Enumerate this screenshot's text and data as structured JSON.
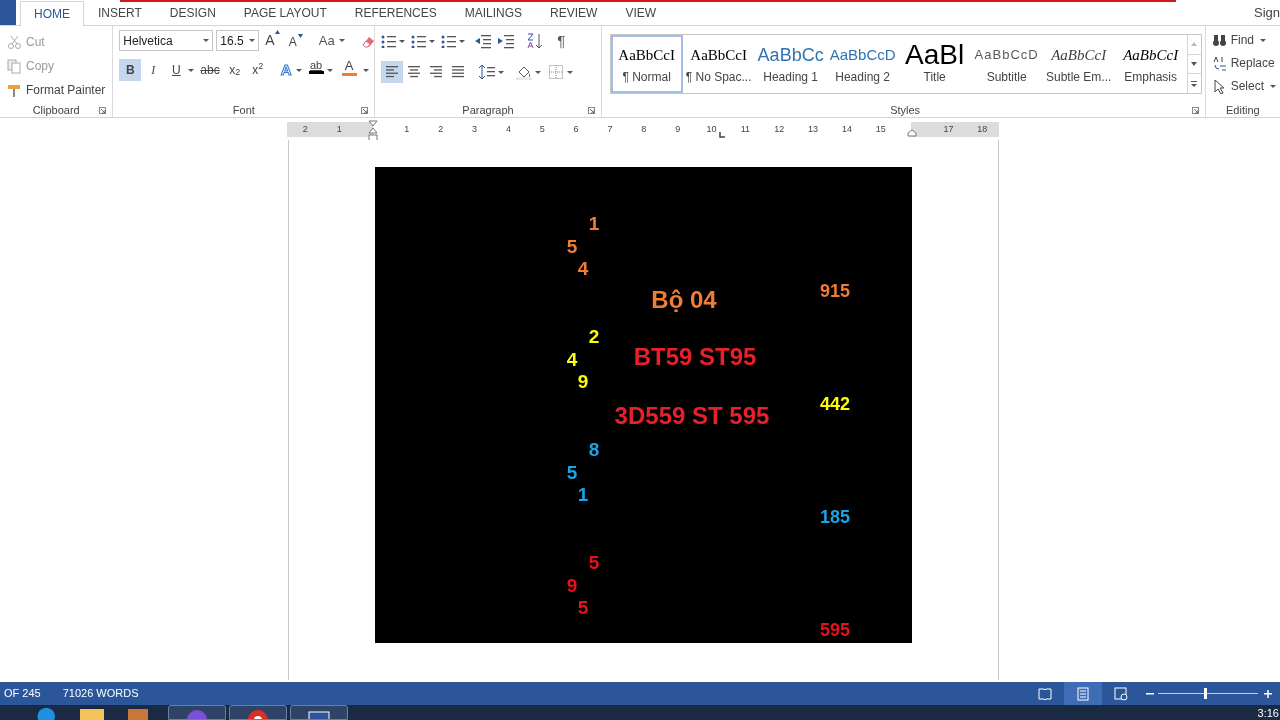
{
  "tabs": [
    {
      "label": "HOME",
      "selected": true
    },
    {
      "label": "INSERT",
      "selected": false
    },
    {
      "label": "DESIGN",
      "selected": false
    },
    {
      "label": "PAGE LAYOUT",
      "selected": false
    },
    {
      "label": "REFERENCES",
      "selected": false
    },
    {
      "label": "MAILINGS",
      "selected": false
    },
    {
      "label": "REVIEW",
      "selected": false
    },
    {
      "label": "VIEW",
      "selected": false
    }
  ],
  "account": "Sign",
  "clipboard": {
    "label": "Clipboard",
    "commands": [
      "Cut",
      "Copy",
      "Format Painter"
    ]
  },
  "font": {
    "label": "Font",
    "name": "Helvetica",
    "size": "16.5",
    "grow": "A",
    "shrink": "A",
    "case": "Aa",
    "effects": "A",
    "highlight": "ab",
    "font_color": "A",
    "buttons": [
      {
        "label": "B",
        "selected": true
      },
      {
        "label": "I",
        "selected": false
      },
      {
        "label": "U",
        "selected": false
      },
      {
        "label": "abc",
        "selected": false
      },
      {
        "label": "x$_{2}$",
        "selected": false
      },
      {
        "label": "x$^{2}$",
        "selected": false
      }
    ]
  },
  "paragraph": {
    "label": "Paragraph",
    "pilcrow": "¶",
    "alignments": [
      {
        "selected": true
      },
      {
        "selected": false
      },
      {
        "selected": false
      },
      {
        "selected": false
      }
    ]
  },
  "styles": {
    "label": "Styles",
    "items": [
      {
        "kind": "normal",
        "preview": "AaBbCcI",
        "label": "¶ Normal",
        "selected": true
      },
      {
        "kind": "nospacing",
        "preview": "AaBbCcI",
        "label": "¶ No Spac...",
        "selected": false
      },
      {
        "kind": "heading1",
        "preview": "AaBbCc",
        "label": "Heading 1",
        "selected": false
      },
      {
        "kind": "heading2",
        "preview": "AaBbCcD",
        "label": "Heading 2",
        "selected": false
      },
      {
        "kind": "title",
        "preview": "AaBl",
        "label": "Title",
        "selected": false
      },
      {
        "kind": "subtitle",
        "preview": "AaBbCcD",
        "label": "Subtitle",
        "selected": false
      },
      {
        "kind": "subtle",
        "preview": "AaBbCcI",
        "label": "Subtle Em...",
        "selected": false
      },
      {
        "kind": "emphasis",
        "preview": "AaBbCcI",
        "label": "Emphasis",
        "selected": false
      }
    ]
  },
  "editing": {
    "label": "Editing",
    "commands": [
      "Find",
      "Replace",
      "Select"
    ]
  },
  "ruler": {
    "labels": [
      "2",
      "1",
      "1",
      "2",
      "3",
      "4",
      "5",
      "6",
      "7",
      "8",
      "9",
      "10",
      "11",
      "12",
      "13",
      "14",
      "15",
      "17",
      "18"
    ]
  },
  "document_image": {
    "title": {
      "text": "Bộ 04",
      "color": "#f07d32"
    },
    "lines": [
      {
        "text": "BT59 ST95",
        "color": "#e8202a"
      },
      {
        "text": "3D559 ST 595",
        "color": "#e8202a"
      }
    ],
    "groups": [
      {
        "color": "#f07d32",
        "digits": [
          "1",
          "5",
          "4"
        ],
        "number": "915"
      },
      {
        "color": "#ffff00",
        "digits": [
          "2",
          "4",
          "9"
        ],
        "number": "442"
      },
      {
        "color": "#1aa3e8",
        "digits": [
          "8",
          "5",
          "1"
        ],
        "number": "185"
      },
      {
        "color": "#e8101a",
        "digits": [
          "5",
          "9",
          "5"
        ],
        "number": "595"
      }
    ]
  },
  "status_bar": {
    "page": "OF 245",
    "words": "71026 WORDS",
    "zoom": {
      "level": 0.46
    }
  },
  "taskbar": {
    "clock": "3:16"
  }
}
